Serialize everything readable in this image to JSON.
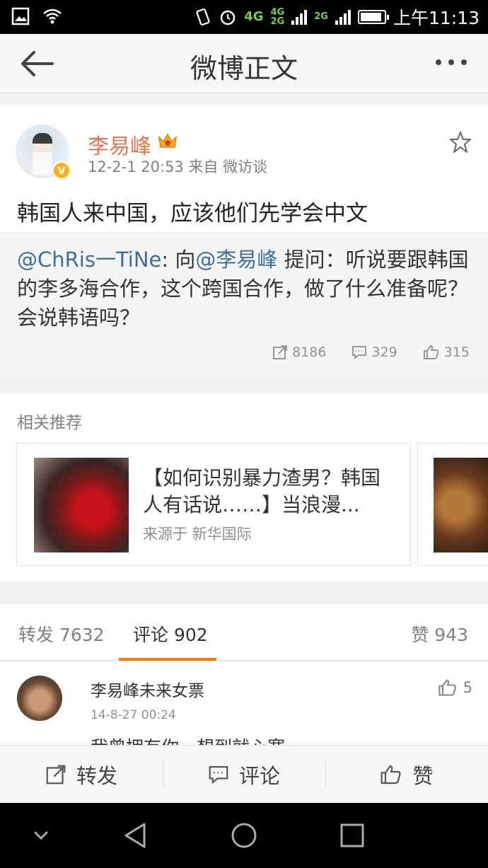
{
  "status_bar": {
    "network_4g": "4G",
    "network_4g_small": "4G",
    "network_2g_small": "2G",
    "network_2g": "2G",
    "time": "上午11:13",
    "battery_level": 0.9
  },
  "header": {
    "title": "微博正文"
  },
  "post": {
    "author": "李易峰",
    "verified_badge": "V",
    "meta": "12-2-1 20:53  来自 微访谈",
    "text": "韩国人来中国，应该他们先学会中文",
    "quote": {
      "mention1": "@ChRis一TiNe",
      "colon": ": 向",
      "mention2": "@李易峰",
      "body": " 提问：听说要跟韩国的李多海合作，这个跨国合作，做了什么准备呢？会说韩语吗？"
    },
    "stats": {
      "reposts": "8186",
      "comments": "329",
      "likes": "315"
    }
  },
  "related": {
    "title": "相关推荐",
    "card": {
      "title": "【如何识别暴力渣男？韩国人有话说……】当浪漫...",
      "source": "来源于 新华国际"
    }
  },
  "tabs": {
    "repost": "转发 7632",
    "comment": "评论 902",
    "like": "赞 943"
  },
  "comment": {
    "user": "李易峰未来女票",
    "time": "14-8-27 00:24",
    "likes": "5",
    "text": "我曾拥有你，想到就心寒"
  },
  "actions": {
    "repost": "转发",
    "comment": "评论",
    "like": "赞"
  },
  "colors": {
    "orange": "#eb7350",
    "link": "#3a6ea5",
    "tab_accent": "#f08000",
    "badge": "#f7b217"
  }
}
